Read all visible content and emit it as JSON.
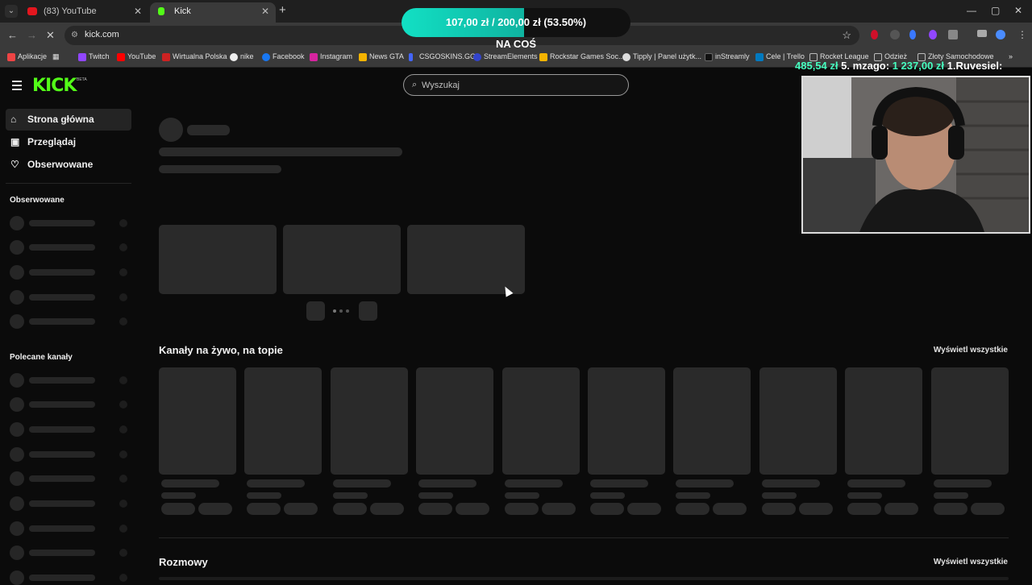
{
  "browser": {
    "tabs": [
      {
        "title": "(83) YouTube",
        "icon": "youtube-icon",
        "color": "#e3161e"
      },
      {
        "title": "Kick",
        "icon": "kick-icon",
        "color": "#53fc18"
      }
    ],
    "url": "kick.com",
    "bookmarks": [
      {
        "label": "Aplikacje",
        "color": "#e44"
      },
      {
        "label": "Twitch",
        "color": "#9146ff"
      },
      {
        "label": "YouTube",
        "color": "#f00"
      },
      {
        "label": "Wirtualna Polska",
        "color": "#c22"
      },
      {
        "label": "nike",
        "color": "#eee"
      },
      {
        "label": "Facebook",
        "color": "#1877f2"
      },
      {
        "label": "Instagram",
        "color": "#d6249f"
      },
      {
        "label": "News GTA",
        "color": "#f5b400"
      },
      {
        "label": "CSGOSKINS.GG",
        "color": "#4466ff"
      },
      {
        "label": "StreamElements",
        "color": "#3344cc"
      },
      {
        "label": "Rockstar Games Soc...",
        "color": "#f5b400"
      },
      {
        "label": "Tipply | Panel użytk...",
        "color": "#ddd"
      },
      {
        "label": "inStreamly",
        "color": "#111"
      },
      {
        "label": "Cele | Trello",
        "color": "#0079bf"
      },
      {
        "label": "Rocket League",
        "color": "#666"
      },
      {
        "label": "Odzież",
        "color": "#666"
      },
      {
        "label": "Złoty Samochodowe",
        "color": "#666"
      }
    ]
  },
  "overlay": {
    "goal_text": "107,00 zł  /  200,00 zł  (53.50%)",
    "goal_progress": 0.535,
    "goal_caption": "NA COŚ",
    "ticker_amount_1": "485,54 zł",
    "ticker_rank_1": "5. mzago:",
    "ticker_amount_2": "1 237,00 zł",
    "ticker_rank_2": "1.Ruvesiel:"
  },
  "kick": {
    "logo": "KICK",
    "logo_badge": "BETA",
    "search_placeholder": "Wyszukaj",
    "nav": [
      {
        "label": "Strona główna",
        "icon": "home-icon"
      },
      {
        "label": "Przeglądaj",
        "icon": "browse-icon"
      },
      {
        "label": "Obserwowane",
        "icon": "heart-icon"
      }
    ],
    "sidebar_following_title": "Obserwowane",
    "sidebar_recommended_title": "Polecane kanały",
    "section_live": "Kanały na żywo, na topie",
    "section_talk": "Rozmowy",
    "view_all": "Wyświetl wszystkie"
  },
  "colors": {
    "accent": "#53fc18",
    "background": "#0b0b0b",
    "skeleton": "#2a2a2a",
    "goal_fill": "#12e0c4",
    "ticker_amount": "#46ffc0"
  }
}
